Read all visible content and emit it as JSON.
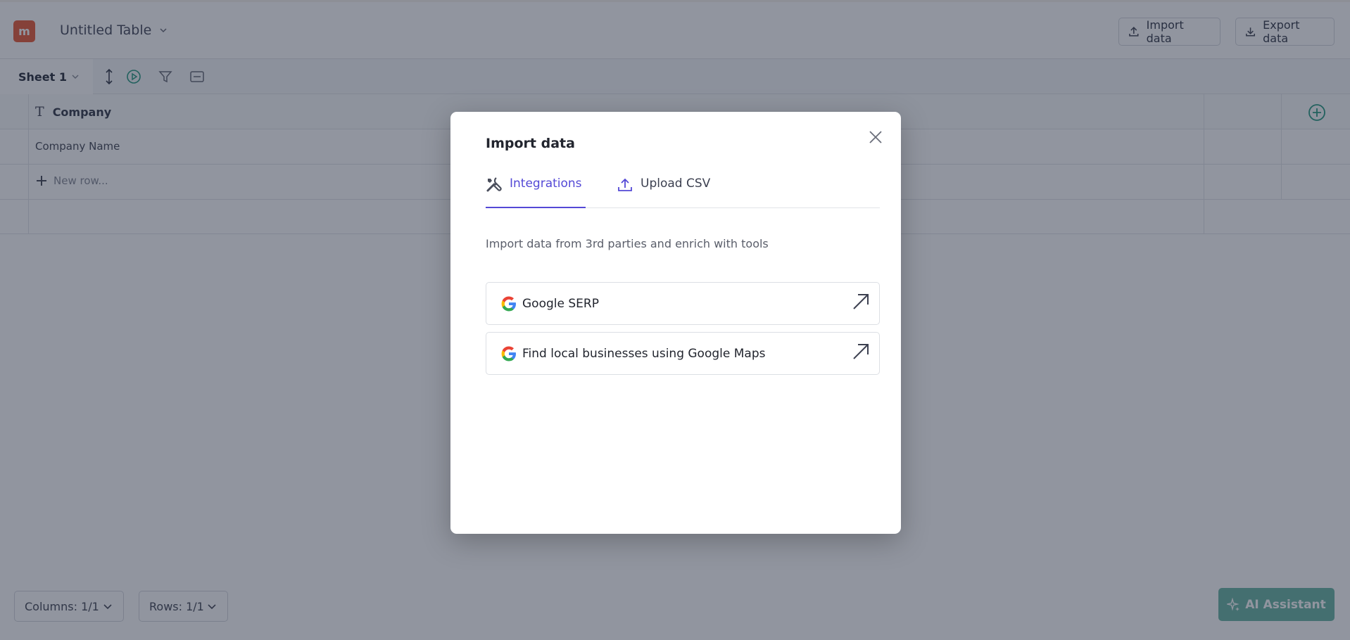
{
  "app": {
    "logo_letter": "m",
    "table_title": "Untitled Table",
    "import_label": "Import data",
    "export_label": "Export data"
  },
  "toolbar": {
    "sheet_label": "Sheet 1"
  },
  "grid": {
    "column_header": "Company",
    "cell_value": "Company Name",
    "new_row_label": "New row..."
  },
  "footer": {
    "columns_label": "Columns: 1/1",
    "rows_label": "Rows: 1/1",
    "ai_label": "AI Assistant"
  },
  "modal": {
    "title": "Import data",
    "tabs": [
      {
        "label": "Integrations",
        "icon": "tools-icon",
        "active": true
      },
      {
        "label": "Upload CSV",
        "icon": "upload-icon",
        "active": false
      }
    ],
    "description": "Import data from 3rd parties and enrich with tools",
    "integrations": [
      {
        "label": "Google SERP",
        "icon": "google-icon"
      },
      {
        "label": "Find local businesses using Google Maps",
        "icon": "google-icon"
      }
    ]
  },
  "colors": {
    "accent": "#5449d6",
    "logo": "#e9613f",
    "ai_button": "#6fb8a7",
    "overlay": "rgba(22,30,52,0.47)"
  }
}
